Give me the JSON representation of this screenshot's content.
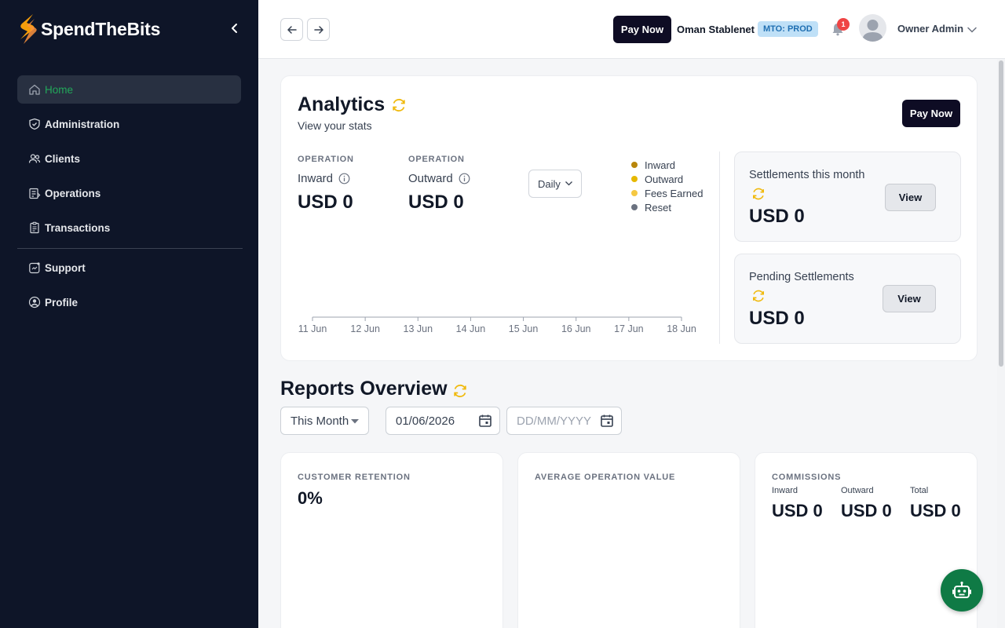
{
  "app": {
    "name": "SpendTheBits"
  },
  "sidebar": {
    "items": [
      {
        "label": "Home",
        "icon": "home-icon",
        "active": true
      },
      {
        "label": "Administration",
        "icon": "shield-icon"
      },
      {
        "label": "Clients",
        "icon": "users-icon"
      },
      {
        "label": "Operations",
        "icon": "operations-icon"
      },
      {
        "label": "Transactions",
        "icon": "clipboard-icon"
      },
      {
        "label": "Support",
        "icon": "support-icon"
      },
      {
        "label": "Profile",
        "icon": "user-circle-icon"
      }
    ]
  },
  "topbar": {
    "pay_now": "Pay Now",
    "org_name": "Oman Stablenet",
    "mto_badge": "MTO: PROD",
    "notification_count": "1",
    "user_name": "Owner Admin"
  },
  "analytics": {
    "title": "Analytics",
    "subtitle": "View your stats",
    "pay_now": "Pay Now",
    "inward": {
      "section": "OPERATION",
      "name": "Inward",
      "value": "USD 0"
    },
    "outward": {
      "section": "OPERATION",
      "name": "Outward",
      "value": "USD 0"
    },
    "period": "Daily",
    "legend": [
      {
        "label": "Inward",
        "color": "#b8860b"
      },
      {
        "label": "Outward",
        "color": "#e6b800"
      },
      {
        "label": "Fees Earned",
        "color": "#f5c842"
      },
      {
        "label": "Reset",
        "color": "#6b7280"
      }
    ],
    "x_labels": [
      "11 Jun",
      "12 Jun",
      "13 Jun",
      "14 Jun",
      "15 Jun",
      "16 Jun",
      "17 Jun",
      "18 Jun"
    ],
    "settlements_month": {
      "title": "Settlements this month",
      "value": "USD 0",
      "button": "View"
    },
    "pending_settlements": {
      "title": "Pending Settlements",
      "value": "USD 0",
      "button": "View"
    }
  },
  "reports": {
    "title": "Reports Overview",
    "range_select": "This Month",
    "start_date": "01/06/2026",
    "end_date_placeholder": "DD/MM/YYYY",
    "customer_retention": {
      "label": "CUSTOMER RETENTION",
      "value": "0%"
    },
    "average_operation": {
      "label": "AVERAGE OPERATION VALUE"
    },
    "commissions": {
      "label": "COMMISSIONS",
      "inward_label": "Inward",
      "inward_value": "USD 0",
      "outward_label": "Outward",
      "outward_value": "USD 0",
      "total_label": "Total",
      "total_value": "USD 0"
    }
  },
  "colors": {
    "sidebar_bg": "#0e1528",
    "active_green": "#22a85a",
    "refresh_yellow": "#f0b90b",
    "primary_dark": "#0e0c24"
  }
}
